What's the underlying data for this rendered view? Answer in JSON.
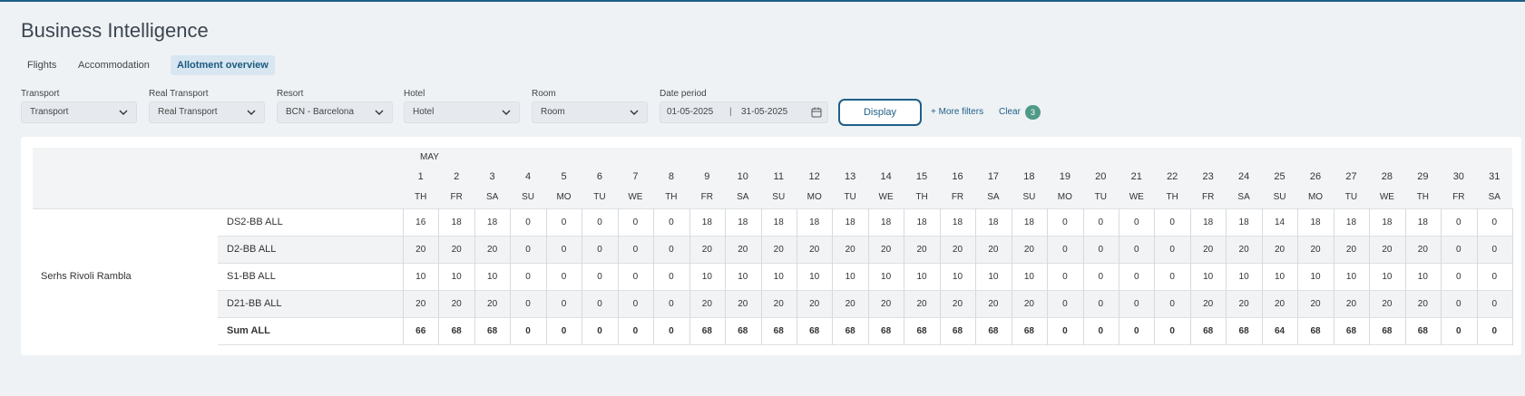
{
  "page_title": "Business Intelligence",
  "tabs": [
    {
      "label": "Flights",
      "active": false
    },
    {
      "label": "Accommodation",
      "active": false
    },
    {
      "label": "Allotment overview",
      "active": true
    }
  ],
  "filters": {
    "transport": {
      "label": "Transport",
      "value": "Transport"
    },
    "real_transport": {
      "label": "Real Transport",
      "value": "Real Transport"
    },
    "resort": {
      "label": "Resort",
      "value": "BCN - Barcelona"
    },
    "hotel": {
      "label": "Hotel",
      "value": "Hotel"
    },
    "room": {
      "label": "Room",
      "value": "Room"
    },
    "date_period": {
      "label": "Date period",
      "from": "01-05-2025",
      "separator": "|",
      "to": "31-05-2025"
    }
  },
  "actions": {
    "display_label": "Display",
    "more_filters_label": "+ More filters",
    "clear_label": "Clear",
    "clear_count": "3"
  },
  "colors": {
    "accent": "#1f5f86",
    "badge": "#4f9a87",
    "active_tab_bg": "#d7e6f1"
  },
  "table": {
    "month": "MAY",
    "days": [
      {
        "n": "1",
        "w": "TH"
      },
      {
        "n": "2",
        "w": "FR"
      },
      {
        "n": "3",
        "w": "SA"
      },
      {
        "n": "4",
        "w": "SU"
      },
      {
        "n": "5",
        "w": "MO"
      },
      {
        "n": "6",
        "w": "TU"
      },
      {
        "n": "7",
        "w": "WE"
      },
      {
        "n": "8",
        "w": "TH"
      },
      {
        "n": "9",
        "w": "FR"
      },
      {
        "n": "10",
        "w": "SA"
      },
      {
        "n": "11",
        "w": "SU"
      },
      {
        "n": "12",
        "w": "MO"
      },
      {
        "n": "13",
        "w": "TU"
      },
      {
        "n": "14",
        "w": "WE"
      },
      {
        "n": "15",
        "w": "TH"
      },
      {
        "n": "16",
        "w": "FR"
      },
      {
        "n": "17",
        "w": "SA"
      },
      {
        "n": "18",
        "w": "SU"
      },
      {
        "n": "19",
        "w": "MO"
      },
      {
        "n": "20",
        "w": "TU"
      },
      {
        "n": "21",
        "w": "WE"
      },
      {
        "n": "22",
        "w": "TH"
      },
      {
        "n": "23",
        "w": "FR"
      },
      {
        "n": "24",
        "w": "SA"
      },
      {
        "n": "25",
        "w": "SU"
      },
      {
        "n": "26",
        "w": "MO"
      },
      {
        "n": "27",
        "w": "TU"
      },
      {
        "n": "28",
        "w": "WE"
      },
      {
        "n": "29",
        "w": "TH"
      },
      {
        "n": "30",
        "w": "FR"
      },
      {
        "n": "31",
        "w": "SA"
      }
    ],
    "hotel_name": "Serhs Rivoli Rambla",
    "rows": [
      {
        "label": "DS2-BB ALL",
        "bold": false,
        "values": [
          "16",
          "18",
          "18",
          "0",
          "0",
          "0",
          "0",
          "0",
          "18",
          "18",
          "18",
          "18",
          "18",
          "18",
          "18",
          "18",
          "18",
          "18",
          "0",
          "0",
          "0",
          "0",
          "18",
          "18",
          "14",
          "18",
          "18",
          "18",
          "18",
          "0",
          "0"
        ]
      },
      {
        "label": "D2-BB ALL",
        "bold": false,
        "values": [
          "20",
          "20",
          "20",
          "0",
          "0",
          "0",
          "0",
          "0",
          "20",
          "20",
          "20",
          "20",
          "20",
          "20",
          "20",
          "20",
          "20",
          "20",
          "0",
          "0",
          "0",
          "0",
          "20",
          "20",
          "20",
          "20",
          "20",
          "20",
          "20",
          "0",
          "0"
        ]
      },
      {
        "label": "S1-BB ALL",
        "bold": false,
        "values": [
          "10",
          "10",
          "10",
          "0",
          "0",
          "0",
          "0",
          "0",
          "10",
          "10",
          "10",
          "10",
          "10",
          "10",
          "10",
          "10",
          "10",
          "10",
          "0",
          "0",
          "0",
          "0",
          "10",
          "10",
          "10",
          "10",
          "10",
          "10",
          "10",
          "0",
          "0"
        ]
      },
      {
        "label": "D21-BB ALL",
        "bold": false,
        "values": [
          "20",
          "20",
          "20",
          "0",
          "0",
          "0",
          "0",
          "0",
          "20",
          "20",
          "20",
          "20",
          "20",
          "20",
          "20",
          "20",
          "20",
          "20",
          "0",
          "0",
          "0",
          "0",
          "20",
          "20",
          "20",
          "20",
          "20",
          "20",
          "20",
          "0",
          "0"
        ]
      },
      {
        "label": "Sum ALL",
        "bold": true,
        "values": [
          "66",
          "68",
          "68",
          "0",
          "0",
          "0",
          "0",
          "0",
          "68",
          "68",
          "68",
          "68",
          "68",
          "68",
          "68",
          "68",
          "68",
          "68",
          "0",
          "0",
          "0",
          "0",
          "68",
          "68",
          "64",
          "68",
          "68",
          "68",
          "68",
          "0",
          "0"
        ]
      }
    ]
  }
}
